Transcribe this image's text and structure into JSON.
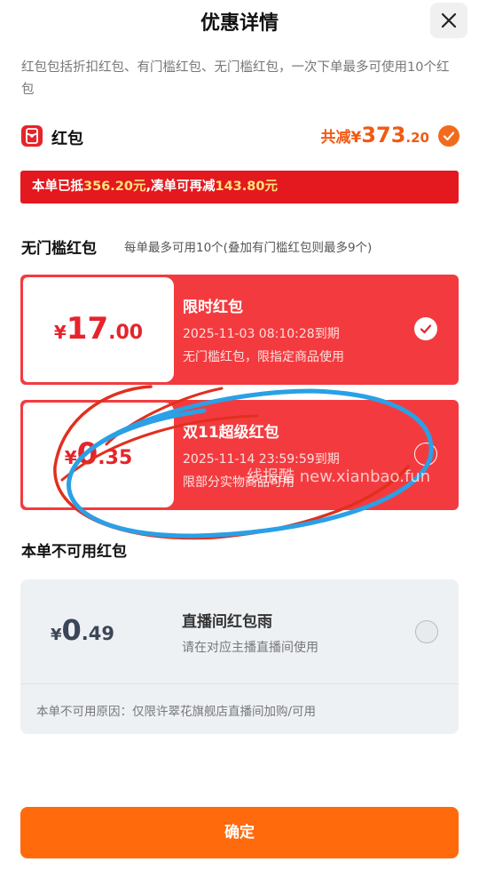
{
  "header": {
    "title": "优惠详情"
  },
  "description": "红包包括折扣红包、有门槛红包、无门槛红包，一次下单最多可使用10个红包",
  "hongbao": {
    "label": "红包",
    "total_label": "共减",
    "total_currency": "¥",
    "total_int": "373",
    "total_dec": ".20"
  },
  "banner": {
    "prefix": "本单已抵",
    "used": "356.20元",
    "middle": ",凑单可再减",
    "more": "143.80元"
  },
  "section_no_threshold": {
    "title": "无门槛红包",
    "note": "每单最多可用10个(叠加有门槛红包则最多9个)"
  },
  "coupons": [
    {
      "currency": "¥",
      "int": "17",
      "dec": ".00",
      "name": "限时红包",
      "expire": "2025-11-03 08:10:28到期",
      "rule": "无门槛红包，限指定商品使用",
      "selected": true
    },
    {
      "currency": "¥",
      "int": "0",
      "dec": ".35",
      "name": "双11超级红包",
      "expire": "2025-11-14 23:59:59到期",
      "rule": "限部分实物商品可用",
      "selected": false
    }
  ],
  "section_unavailable": {
    "title": "本单不可用红包"
  },
  "unavailable": {
    "currency": "¥",
    "int": "0",
    "dec": ".49",
    "name": "直播间红包雨",
    "rule": "请在对应主播直播间使用",
    "reason": "本单不可用原因：仅限许翠花旗舰店直播间加购/可用"
  },
  "watermark": "线报酷 new.xianbao.fun",
  "confirm_label": "确定",
  "colors": {
    "red": "#f33b3f",
    "orange": "#ff6a0d",
    "banner_red": "#e3191f"
  }
}
